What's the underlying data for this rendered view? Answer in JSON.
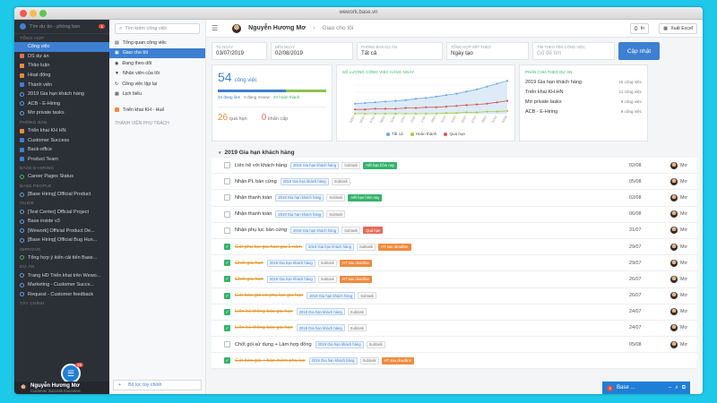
{
  "window": {
    "title": "wework.base.vn"
  },
  "sidebar": {
    "search_placeholder": "Tìm dự án - phòng ban",
    "notif_count": "1",
    "sections": [
      {
        "label": "TỔNG HỢP",
        "items": [
          {
            "label": "Công việc",
            "icon": "square-icon",
            "color": "#3d7fd0",
            "active": true
          },
          {
            "label": "DS dự án",
            "icon": "square-icon",
            "color": "#e56a5a"
          },
          {
            "label": "Thảo luận",
            "icon": "square-icon",
            "color": "#ef8a3e"
          },
          {
            "label": "Hoạt động",
            "icon": "square-icon",
            "color": "#ef8a3e"
          },
          {
            "label": "Thành viên",
            "icon": "square-icon",
            "color": "#3d7fd0"
          },
          {
            "label": "2019 Gia hạn khách hàng",
            "icon": "ring-icon"
          },
          {
            "label": "ACB - E-Hiring",
            "icon": "ring-icon"
          },
          {
            "label": "Mơ private tasks",
            "icon": "ring-icon"
          }
        ]
      },
      {
        "label": "PHÒNG BAN",
        "items": [
          {
            "label": "Triển khai KH HN",
            "icon": "square-icon",
            "color": "#ef8a3e"
          },
          {
            "label": "Customer Success",
            "icon": "square-icon",
            "color": "#3d7fd0"
          },
          {
            "label": "Back-office",
            "icon": "square-icon",
            "color": "#3d7fd0"
          },
          {
            "label": "Product Team",
            "icon": "square-icon",
            "color": "#3d7fd0"
          }
        ]
      },
      {
        "label": "BASE E-HIRING",
        "items": [
          {
            "label": "Career Pages Status",
            "icon": "ring-icon",
            "green": true
          }
        ]
      },
      {
        "label": "BASE PEOPLE",
        "items": [
          {
            "label": "[Base Hiring] Official Product",
            "icon": "ring-icon"
          }
        ]
      },
      {
        "label": "GUIDE",
        "items": [
          {
            "label": "[Test Center] Official Project",
            "icon": "ring-icon"
          },
          {
            "label": "Base inside v3",
            "icon": "ring-icon"
          },
          {
            "label": "[Wework] Official Product De...",
            "icon": "ring-icon"
          },
          {
            "label": "[Base Hiring] Official Bug Hun...",
            "icon": "ring-icon"
          }
        ]
      },
      {
        "label": "IMPROVE",
        "items": [
          {
            "label": "Tổng hợp ý kiến cải tiến Base...",
            "icon": "ring-icon",
            "green": true
          }
        ]
      },
      {
        "label": "DỰ ÁN",
        "items": [
          {
            "label": "Trang HD Triển khai trên Wewo...",
            "icon": "ring-icon"
          },
          {
            "label": "Marketing - Customer Succe...",
            "icon": "ring-icon"
          },
          {
            "label": "Request - Customer feedback",
            "icon": "ring-icon"
          }
        ]
      },
      {
        "label": "TÀY CHÍNH",
        "items": []
      }
    ],
    "user": {
      "name": "Nguyễn Hương Mơ",
      "role": "Customer Success Executive"
    },
    "fab_badge": "29"
  },
  "panel2": {
    "search_placeholder": "Tìm kiếm công việc",
    "items": [
      {
        "label": "Tổng quan công việc",
        "icon": "overview-icon"
      },
      {
        "label": "Giao cho tôi",
        "icon": "inbox-icon",
        "active": true
      },
      {
        "label": "Đang theo dõi",
        "icon": "eye-icon"
      },
      {
        "label": "Nhân viên của tôi",
        "icon": "filter-icon"
      },
      {
        "label": "Công việc lặp lại",
        "icon": "repeat-icon"
      },
      {
        "label": "Lịch biểu",
        "icon": "calendar-icon"
      }
    ],
    "pinned": {
      "label": "Triển khai KH - Huế",
      "icon": "square-icon"
    },
    "section_label": "THÀNH VIÊN PHỤ TRÁCH",
    "filter_label": "Bộ lọc tùy chỉnh"
  },
  "topbar": {
    "user_name": "Nguyễn Hương Mơ",
    "breadcrumb_sep": "›",
    "breadcrumb": "Giao cho tôi",
    "print_label": "In",
    "export_label": "Xuất Excel"
  },
  "filters": [
    {
      "label": "TỪ NGÀY",
      "value": "03/07/2019"
    },
    {
      "label": "ĐẾN NGÀY",
      "value": "02/08/2019"
    },
    {
      "label": "PHÒNG BAN DỰ ÁN",
      "value": "Tất cả"
    },
    {
      "label": "TỔNG HỢP XẾP THEO",
      "value": "Ngày tạo"
    },
    {
      "label": "TÌM THEO TÊN CÔNG VIỆC",
      "value": "Gõ để tìm",
      "placeholder": true
    }
  ],
  "update_label": "Cập nhật",
  "summary": {
    "total": "54",
    "total_label": "công việc",
    "stats_in_progress": "34 đang làm",
    "stats_review": "0 đang review",
    "stats_done": "20 hoàn thành",
    "progress": {
      "in_progress": 0.63,
      "done": 0.37
    },
    "overdue": "26",
    "overdue_label": "quá hạn",
    "urgent": "0",
    "urgent_label": "khẩn cấp"
  },
  "chart_data": {
    "type": "area",
    "title": "SỐ LƯỢNG CÔNG VIỆC HẰNG NGÀY",
    "x": [
      "03/07",
      "05/07",
      "07/07",
      "09/07",
      "11/07",
      "13/07",
      "15/07",
      "17/07",
      "19/07",
      "21/07",
      "23/07",
      "25/07",
      "27/07",
      "29/07",
      "31/07",
      "02/08"
    ],
    "ylim": [
      0,
      50
    ],
    "series": [
      {
        "name": "Tất cả",
        "color": "#6fa8e6",
        "values": [
          14,
          15,
          16,
          17,
          18,
          19,
          21,
          22,
          24,
          26,
          28,
          31,
          34,
          38,
          42,
          46
        ]
      },
      {
        "name": "Hoàn thành",
        "color": "#a8c93a",
        "values": [
          0,
          0,
          0,
          0,
          0,
          0,
          0,
          0,
          0,
          1,
          1,
          2,
          2,
          3,
          3,
          4
        ]
      },
      {
        "name": "Quá hạn",
        "color": "#d9534f",
        "values": [
          6,
          6,
          7,
          7,
          7,
          8,
          8,
          9,
          9,
          10,
          11,
          12,
          13,
          14,
          16,
          18
        ]
      }
    ]
  },
  "projects": {
    "title": "PHÂN CHIA THEO DỰ ÁN",
    "rows": [
      {
        "name": "2019 Gia hạn khách hàng",
        "count": "15 công việc"
      },
      {
        "name": "Triển khai KH HN",
        "count": "11 công việc"
      },
      {
        "name": "Mơ private tasks",
        "count": "9 công việc"
      },
      {
        "name": "ACB - E-Hiring",
        "count": "9 công việc"
      }
    ]
  },
  "group": {
    "title": "2019 Gia hạn khách hàng"
  },
  "tasks": [
    {
      "name": "Liên hệ với khách hàng",
      "done": false,
      "tags": [
        {
          "t": "2019 Gia hạn khách hàng",
          "k": ""
        },
        {
          "t": "Subtask",
          "k": "sub"
        },
        {
          "t": "Hết hạn hôm nay",
          "k": "green"
        }
      ],
      "date": "02/08",
      "owner": "Mơ"
    },
    {
      "name": "Nhận PL bản cứng",
      "done": false,
      "tags": [
        {
          "t": "2019 Gia hạn khách hàng",
          "k": ""
        },
        {
          "t": "Subtask",
          "k": "sub"
        }
      ],
      "date": "05/08",
      "owner": "Mơ"
    },
    {
      "name": "Nhận thanh toán",
      "done": false,
      "tags": [
        {
          "t": "2019 Gia hạn khách hàng",
          "k": ""
        },
        {
          "t": "Subtask",
          "k": "sub"
        },
        {
          "t": "Hết hạn hôm nay",
          "k": "green"
        }
      ],
      "date": "02/08",
      "owner": "Mơ"
    },
    {
      "name": "Nhận thanh toán",
      "done": false,
      "tags": [
        {
          "t": "2019 Gia hạn khách hàng",
          "k": ""
        },
        {
          "t": "Subtask",
          "k": "sub"
        }
      ],
      "date": "06/08",
      "owner": "Mơ"
    },
    {
      "name": "Nhận phụ lục bản cứng",
      "done": false,
      "tags": [
        {
          "t": "2019 Gia hạn khách hàng",
          "k": ""
        },
        {
          "t": "Subtask",
          "k": "sub"
        },
        {
          "t": "Quá hạn",
          "k": "red"
        }
      ],
      "date": "31/07",
      "owner": "Mơ"
    },
    {
      "name": "Gửi phụ lục gia hạn gia 1 năm",
      "done": true,
      "tags": [
        {
          "t": "2019 Gia hạn khách hàng",
          "k": ""
        },
        {
          "t": "Subtask",
          "k": "sub"
        },
        {
          "t": "HT sau deadline",
          "k": "orange"
        }
      ],
      "date": "29/07",
      "owner": "Mơ"
    },
    {
      "name": "Chốt gia hạn",
      "done": true,
      "tags": [
        {
          "t": "2019 Gia hạn khách hàng",
          "k": ""
        },
        {
          "t": "Subtask",
          "k": "sub"
        },
        {
          "t": "HT sau deadline",
          "k": "orange"
        }
      ],
      "date": "29/07",
      "owner": "Mơ"
    },
    {
      "name": "Chốt gia hạn",
      "done": true,
      "tags": [
        {
          "t": "2019 Gia hạn khách hàng",
          "k": ""
        },
        {
          "t": "Subtask",
          "k": "sub"
        },
        {
          "t": "HT sau deadline",
          "k": "orange"
        }
      ],
      "date": "26/07",
      "owner": "Mơ"
    },
    {
      "name": "Gửi báo giá và phụ lục gia hạn",
      "done": true,
      "tags": [
        {
          "t": "2019 Gia hạn khách hàng",
          "k": ""
        },
        {
          "t": "Subtask",
          "k": "sub"
        }
      ],
      "date": "26/07",
      "owner": "Mơ"
    },
    {
      "name": "Liên hệ thông báo gia hạn",
      "done": true,
      "tags": [
        {
          "t": "2019 Gia hạn khách hàng",
          "k": ""
        },
        {
          "t": "Subtask",
          "k": "sub"
        }
      ],
      "date": "24/07",
      "owner": "Mơ"
    },
    {
      "name": "Liên hệ thông báo gia hạn",
      "done": true,
      "tags": [
        {
          "t": "2019 Gia hạn khách hàng",
          "k": ""
        },
        {
          "t": "Subtask",
          "k": "sub"
        }
      ],
      "date": "24/07",
      "owner": "Mơ"
    },
    {
      "name": "Chốt gói sử dụng + Làm hợp đồng",
      "done": false,
      "tags": [
        {
          "t": "2019 Gia hạn khách hàng",
          "k": ""
        },
        {
          "t": "Subtask",
          "k": "sub"
        }
      ],
      "date": "05/08",
      "owner": "Mơ"
    },
    {
      "name": "Gửi báo giá + bản mềm phụ lục",
      "done": true,
      "tags": [
        {
          "t": "2019 Gia hạn khách hàng",
          "k": ""
        },
        {
          "t": "Subtask",
          "k": "sub"
        },
        {
          "t": "HT sau deadline",
          "k": "orange"
        }
      ],
      "date": "",
      "owner": ""
    }
  ],
  "chat": {
    "count": "3",
    "label": "Base ..."
  }
}
